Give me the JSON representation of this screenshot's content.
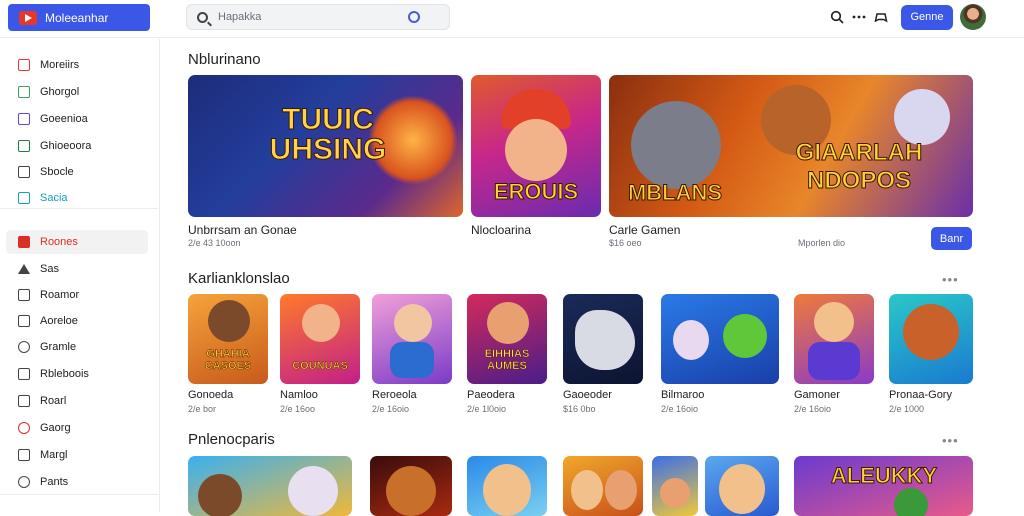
{
  "header": {
    "logo_text": "Moleeanhar",
    "search_placeholder": "Hapakka",
    "signin_label": "Genne",
    "icons": [
      "search-icon",
      "more-icon",
      "gamepad-icon"
    ]
  },
  "sidebar": {
    "items": [
      {
        "label": "Moreiirs",
        "icon": "home-icon",
        "color": "#e8362d"
      },
      {
        "label": "Ghorgol",
        "icon": "games-icon",
        "color": "#34a853"
      },
      {
        "label": "Goeenioa",
        "icon": "apps-icon",
        "color": "#5b4bd6"
      },
      {
        "label": "Ghioeoora",
        "icon": "movies-icon",
        "color": "#1a7f3a"
      },
      {
        "label": "Sbocle",
        "icon": "books-icon",
        "color": "#444444"
      },
      {
        "label": "Sacia",
        "icon": "kids-icon",
        "color": "#12a3b8"
      },
      {
        "label": "Roones",
        "icon": "trending-icon",
        "color": "#d93025",
        "active": true
      },
      {
        "label": "Sas",
        "icon": "star-icon",
        "color": "#444444"
      },
      {
        "label": "Roamor",
        "icon": "list-icon",
        "color": "#444444"
      },
      {
        "label": "Aoreloe",
        "icon": "edit-icon",
        "color": "#444444"
      },
      {
        "label": "Gramle",
        "icon": "gear-icon",
        "color": "#444444"
      },
      {
        "label": "Rbleboois",
        "icon": "library-icon",
        "color": "#444444"
      },
      {
        "label": "Roarl",
        "icon": "gift-icon",
        "color": "#444444"
      },
      {
        "label": "Gaorg",
        "icon": "red-circle-icon",
        "color": "#d93025"
      },
      {
        "label": "Margl",
        "icon": "device-icon",
        "color": "#444444"
      },
      {
        "label": "Pants",
        "icon": "person-icon",
        "color": "#444444"
      }
    ]
  },
  "featured": {
    "title": "Nblurinano",
    "cards": [
      {
        "art": "TUUIC\nUHSING",
        "caption": "Unbrrsam an Gonae",
        "sub": "2/e 43 10oon"
      },
      {
        "art": "EROUIS",
        "caption": "Nlocloarina",
        "sub": ""
      },
      {
        "art": "MBLANS",
        "art2": "GIAARLAH\nNDOPOS",
        "caption": "Carle Gamen",
        "sub": "$16 oeo",
        "sub2": "Mporlen dio",
        "button": "Banr"
      }
    ]
  },
  "row2": {
    "title": "Karlianklonslao",
    "more": "•••",
    "items": [
      {
        "name": "Gonoeda",
        "sub": "2/e bor",
        "art": "GHAHIA\nCASOES"
      },
      {
        "name": "Namloo",
        "sub": "2/e 16oo",
        "art": "COUNUAS"
      },
      {
        "name": "Reroeola",
        "sub": "2/e 16oio",
        "art": ""
      },
      {
        "name": "Paeodera",
        "sub": "2/e 1l0oio",
        "art": "EIHHIAS\nAUMES"
      },
      {
        "name": "Gaoeoder",
        "sub": "$16 0bo",
        "art": ""
      },
      {
        "name": "Bilmaroo",
        "sub": "2/e 16oio",
        "art": ""
      },
      {
        "name": "Gamoner",
        "sub": "2/e 16oio",
        "art": ""
      },
      {
        "name": "Pronaa-Gory",
        "sub": "2/e 1000",
        "art": ""
      }
    ]
  },
  "row3": {
    "title": "Pnlenocparis",
    "more": "•••",
    "art_last": "ALEUKKY"
  }
}
